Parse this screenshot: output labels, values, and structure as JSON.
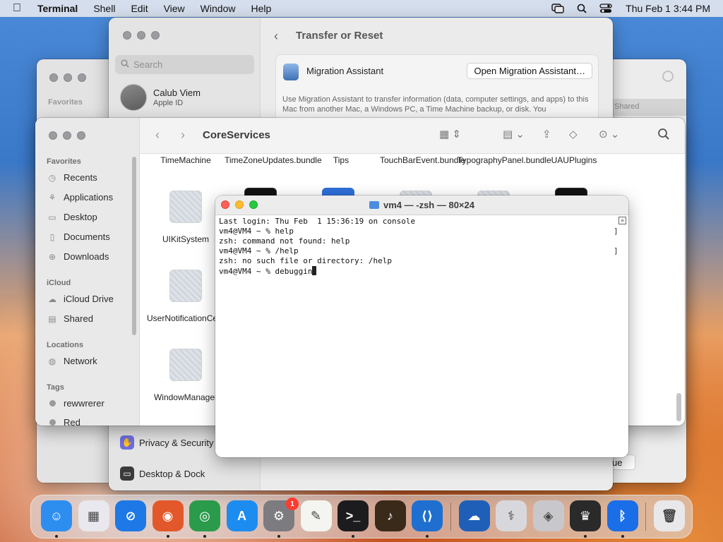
{
  "menubar": {
    "app_name": "Terminal",
    "items": [
      "Shell",
      "Edit",
      "View",
      "Window",
      "Help"
    ],
    "clock": "Thu Feb 1  3:44 PM",
    "status_icons": [
      "screen-mirroring-icon",
      "search-icon",
      "control-center-icon"
    ]
  },
  "back_window": {
    "favorites_label": "Favorites",
    "shared_label": "Shared",
    "button_label": "ue"
  },
  "settings": {
    "search_placeholder": "Search",
    "user_name": "Calub Viem",
    "user_sub": "Apple ID",
    "sidebar_items": [
      {
        "label": "Privacy & Security",
        "icon": "hand-icon",
        "color": "#6e6ee0"
      },
      {
        "label": "Desktop & Dock",
        "icon": "dock-icon",
        "color": "#3a3a3c"
      }
    ],
    "page_title": "Transfer or Reset",
    "migration_label": "Migration Assistant",
    "migration_button": "Open Migration Assistant…",
    "migration_desc": "Use Migration Assistant to transfer information (data, computer settings, and apps) to this Mac from another Mac, a Windows PC, a Time Machine backup, or disk. You"
  },
  "finder": {
    "title": "CoreServices",
    "sections": {
      "favorites": "Favorites",
      "icloud": "iCloud",
      "locations": "Locations",
      "tags": "Tags"
    },
    "favorites": [
      "Recents",
      "Applications",
      "Desktop",
      "Documents",
      "Downloads"
    ],
    "icloud": [
      "iCloud Drive",
      "Shared"
    ],
    "locations": [
      "Network"
    ],
    "tags": [
      "rewwrerer",
      "Red"
    ],
    "top_row": [
      "TimeMachine",
      "TimeZoneUpdates.bundle",
      "Tips",
      "TouchBarEvent.bundle",
      "TypographyPanel.bundle",
      "UAUPlugins"
    ],
    "files": [
      "UIKitSystem",
      "UserNotificationCenter",
      "WindowManager"
    ]
  },
  "terminal": {
    "title": "vm4 — -zsh — 80×24",
    "lines": [
      "Last login: Thu Feb  1 15:36:19 on console",
      "vm4@VM4 ~ % help",
      "zsh: command not found: help",
      "vm4@VM4 ~ % /help",
      "zsh: no such file or directory: /help",
      "vm4@VM4 ~ % debuggin"
    ]
  },
  "dock": {
    "apps": [
      {
        "name": "finder-icon",
        "color": "#2d8ef0",
        "glyph": "☺",
        "running": true
      },
      {
        "name": "launchpad-icon",
        "color": "#e8e8ee",
        "glyph": "▦",
        "running": false
      },
      {
        "name": "safari-icon",
        "color": "#1e78e6",
        "glyph": "⊘",
        "running": false
      },
      {
        "name": "firefox-icon",
        "color": "#e3582b",
        "glyph": "◉",
        "running": true
      },
      {
        "name": "chrome-icon",
        "color": "#2a9b4a",
        "glyph": "◎",
        "running": true
      },
      {
        "name": "app-store-icon",
        "color": "#1c8cf0",
        "glyph": "A",
        "running": false
      },
      {
        "name": "system-settings-icon",
        "color": "#7c7c80",
        "glyph": "⚙",
        "running": true,
        "badge": "1"
      },
      {
        "name": "textedit-icon",
        "color": "#f4f4f0",
        "glyph": "✎",
        "running": false
      },
      {
        "name": "terminal-icon",
        "color": "#1c1c1e",
        "glyph": ">_",
        "running": true
      },
      {
        "name": "garageband-icon",
        "color": "#3a2a1a",
        "glyph": "♪",
        "running": false
      },
      {
        "name": "vscode-icon",
        "color": "#1e6fd0",
        "glyph": "⟨⟩",
        "running": true
      }
    ],
    "utilities": [
      {
        "name": "weather-icon",
        "color": "#1f5fb8",
        "glyph": "☁",
        "running": false
      },
      {
        "name": "disk-utility-icon",
        "color": "#d8d8dc",
        "glyph": "⚕",
        "running": false
      },
      {
        "name": "bootcamp-icon",
        "color": "#c8c8cc",
        "glyph": "◈",
        "running": false
      },
      {
        "name": "alfred-icon",
        "color": "#2a2a2a",
        "glyph": "♛",
        "running": true
      },
      {
        "name": "bluetooth-icon",
        "color": "#1a6ee8",
        "glyph": "ᛒ",
        "running": true
      }
    ],
    "trash": {
      "name": "trash-icon",
      "color": "#e8e8ea",
      "glyph": "🗑"
    }
  }
}
